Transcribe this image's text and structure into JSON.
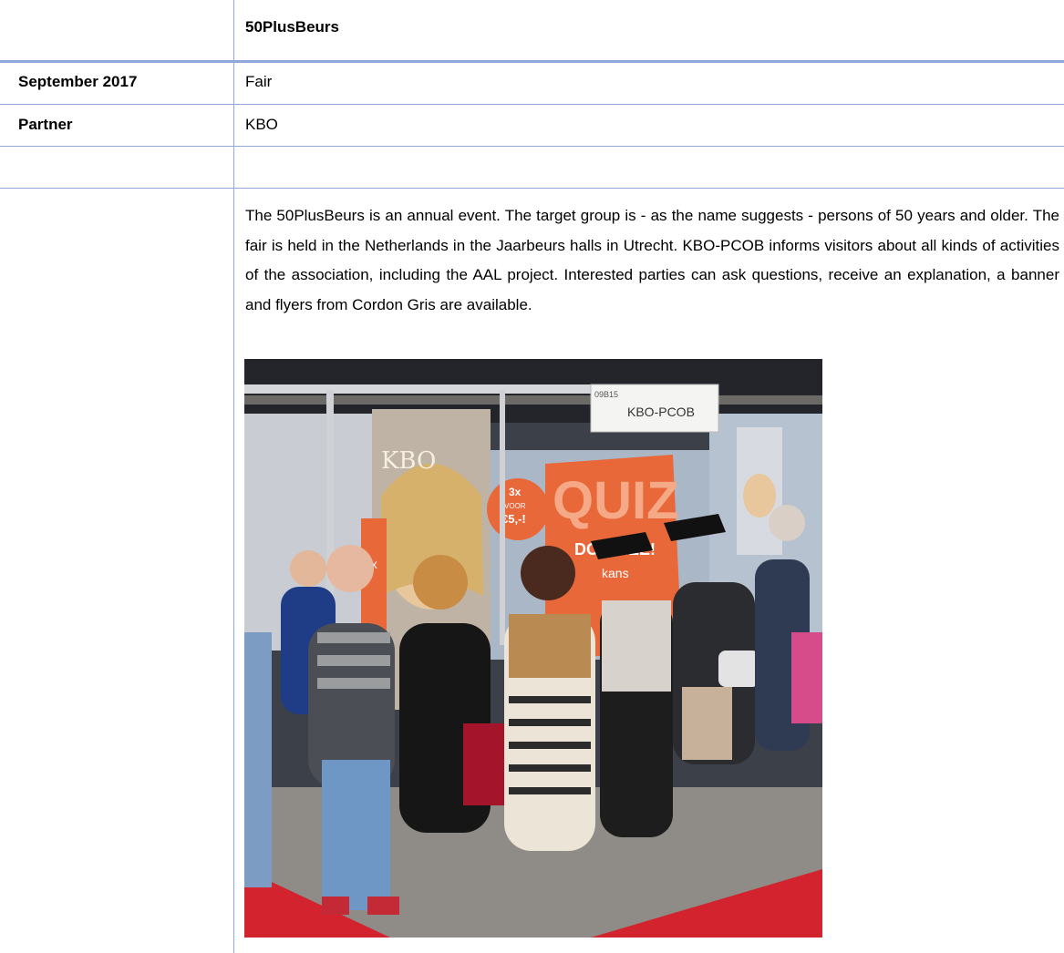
{
  "table": {
    "header_title": "50PlusBeurs",
    "rows": [
      {
        "label": "September 2017",
        "value": "Fair"
      },
      {
        "label": "Partner",
        "value": "KBO"
      }
    ],
    "description": "The 50PlusBeurs is an annual event. The target group is - as the name suggests - persons of 50 years and older. The fair is held in the Netherlands in the Jaarbeurs halls in Utrecht. KBO-PCOB informs visitors about all kinds of activities of the association, including the AAL project. Interested parties can ask questions, receive an explanation, a banner and flyers from Cordon Gris are available."
  },
  "photo": {
    "booth_sign_number": "09B15",
    "booth_sign_name": "KBO-PCOB",
    "poster_logo": "KBO",
    "quiz_word": "QUIZ",
    "quiz_sub": "DOE MEE!",
    "price_badge_lines": [
      "3x",
      "VOOR",
      "€5,-!"
    ],
    "side_badge": "3x",
    "kans_text": "kans",
    "colors": {
      "booth_orange": "#e9683a",
      "booth_wall": "#aab7c7",
      "red_carpet": "#d3232e"
    }
  }
}
